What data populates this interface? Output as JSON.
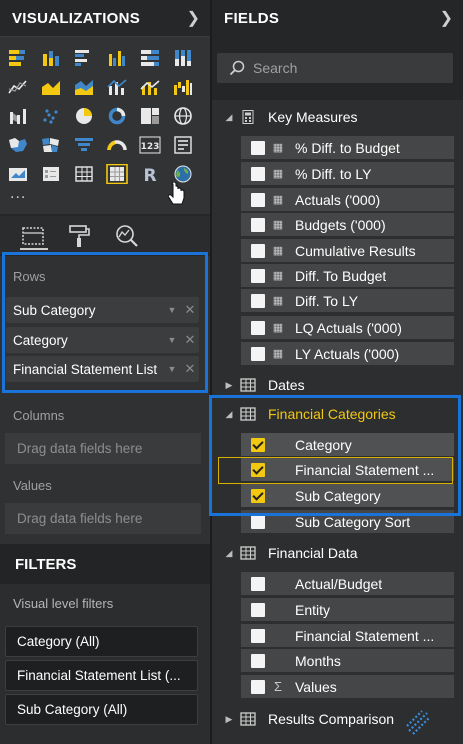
{
  "visualizations": {
    "title": "VISUALIZATIONS",
    "more_label": "..."
  },
  "viz_icons": [
    "stacked-bar-icon",
    "stacked-column-icon",
    "clustered-bar-icon",
    "clustered-column-icon",
    "100pct-bar-icon",
    "100pct-column-icon",
    "line-chart-icon",
    "area-chart-icon",
    "stacked-area-icon",
    "line-column-icon",
    "line-stacked-column-icon",
    "waterfall-icon",
    "ribbon-chart-icon",
    "scatter-chart-icon",
    "pie-chart-icon",
    "donut-chart-icon",
    "treemap-icon",
    "map-icon",
    "filled-map-icon",
    "shape-map-icon",
    "funnel-icon",
    "gauge-icon",
    "card-icon",
    "multi-row-card-icon",
    "kpi-icon",
    "slicer-icon",
    "table-icon",
    "matrix-icon",
    "r-visual-icon",
    "globe-icon"
  ],
  "tools": [
    "fields-tool-icon",
    "format-paint-roller-icon",
    "analytics-magnifier-icon"
  ],
  "wells": {
    "rows_label": "Rows",
    "rows": [
      "Sub Category",
      "Category",
      "Financial Statement List"
    ],
    "columns_label": "Columns",
    "values_label": "Values",
    "drag_placeholder": "Drag data fields here"
  },
  "filters": {
    "title": "FILTERS",
    "visual_level_label": "Visual level filters",
    "items": [
      "Category (All)",
      "Financial Statement List (...",
      "Sub Category (All)"
    ]
  },
  "fields": {
    "title": "FIELDS",
    "search_placeholder": "Search",
    "tables": [
      {
        "name": "Key Measures",
        "expanded": true,
        "items": [
          "% Diff. to Budget",
          "% Diff. to LY",
          "Actuals ('000)",
          "Budgets ('000)",
          "Cumulative Results",
          "Diff. To Budget",
          "Diff. To LY",
          "LQ Actuals ('000)",
          "LY Actuals ('000)"
        ]
      },
      {
        "name": "Dates",
        "expanded": false,
        "items": []
      },
      {
        "name": "Financial Categories",
        "expanded": true,
        "highlight": "#f2c811",
        "items": [
          "Category",
          "Financial Statement ...",
          "Sub Category",
          "Sub Category Sort"
        ],
        "checked": [
          true,
          true,
          true,
          false
        ]
      },
      {
        "name": "Financial Data",
        "expanded": true,
        "items": [
          "Actual/Budget",
          "Entity",
          "Financial Statement ...",
          "Months",
          "Values"
        ]
      },
      {
        "name": "Results Comparison",
        "expanded": false,
        "items": []
      }
    ]
  },
  "colors": {
    "selection_outline": "#1a73d9",
    "accent_yellow": "#f2c811",
    "pane_bg": "#262728"
  }
}
